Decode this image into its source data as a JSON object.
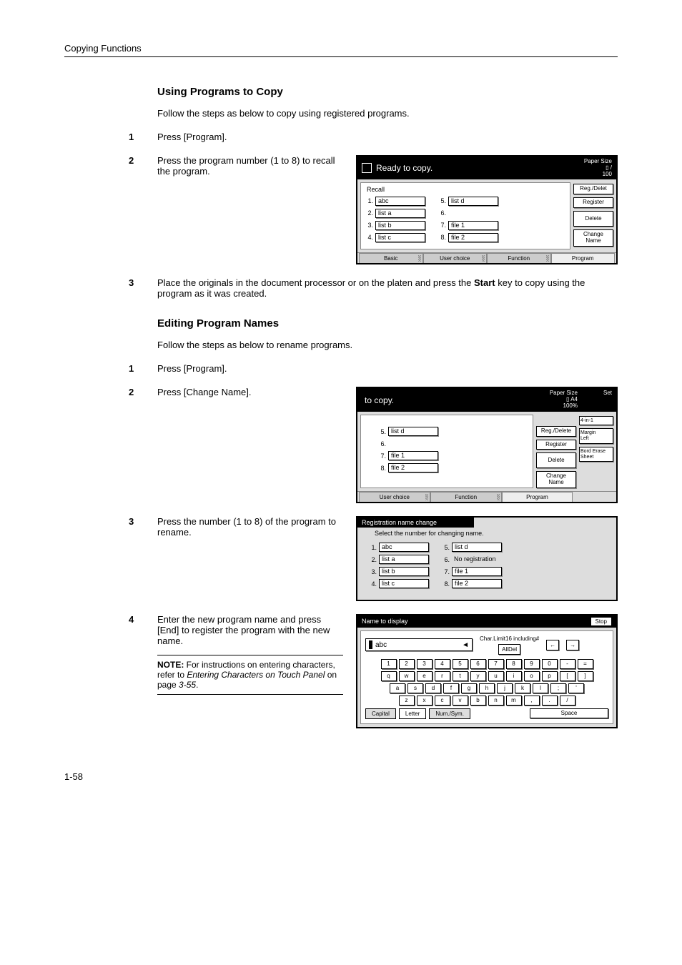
{
  "running_head": "Copying Functions",
  "section1": {
    "title": "Using Programs to Copy",
    "intro": "Follow the steps as below to copy using registered programs.",
    "steps": {
      "s1": {
        "text": "Press [Program]."
      },
      "s2": {
        "text": "Press the program number (1 to 8) to recall the program."
      },
      "s3": {
        "text_a": "Place the originals in the document processor or on the platen and press the ",
        "bold": "Start",
        "text_b": " key to copy using the program as it was created."
      }
    }
  },
  "section2": {
    "title": "Editing Program Names",
    "intro": "Follow the steps as below to rename programs.",
    "steps": {
      "s1": {
        "text": "Press [Program]."
      },
      "s2": {
        "text": "Press [Change Name]."
      },
      "s3": {
        "text": "Press the number (1 to 8) of the program to rename."
      },
      "s4": {
        "text": "Enter the new program name and press [End] to register the program with the new name."
      }
    },
    "note": {
      "label": "NOTE:",
      "a": " For instructions on entering characters, refer to ",
      "link": "Entering Characters on Touch Panel",
      "b": " on page ",
      "page": "3-55",
      "c": "."
    }
  },
  "screen1": {
    "title": "Ready to copy.",
    "paper": "Paper Size",
    "zoom": "100",
    "recall": "Recall",
    "slots": {
      "l1": "abc",
      "l2": "list a",
      "l3": "list b",
      "l4": "list c",
      "r5": "list d",
      "r6": "",
      "r7": "file 1",
      "r8": "file 2"
    },
    "side": {
      "regdel": "Reg./Delet",
      "register": "Register",
      "delete": "Delete",
      "change": "Change\nName"
    },
    "tabs": {
      "basic": "Basic",
      "user": "User choice",
      "func": "Function",
      "prog": "Program"
    }
  },
  "screen2": {
    "title": "to copy.",
    "paper": "Paper Size",
    "papersize": "A4",
    "zoom": "100%",
    "set": "Set",
    "slots": {
      "r5": "list d",
      "r6": "",
      "r7": "file 1",
      "r8": "file 2"
    },
    "side": {
      "regdel": "Reg./Delete",
      "register": "Register",
      "delete": "Delete",
      "change": "Change\nName"
    },
    "shortcuts": {
      "a": "4-in-1",
      "b": "Margin\nLeft",
      "c": "Bord Erase\nSheet"
    },
    "tabs": {
      "user": "User choice",
      "func": "Function",
      "prog": "Program"
    }
  },
  "screen3": {
    "bar": "Registration name change",
    "sub": "Select the number for changing name.",
    "slots": {
      "l1": "abc",
      "l2": "list a",
      "l3": "list b",
      "l4": "list c",
      "r5": "list d",
      "r6": "No registration",
      "r7": "file 1",
      "r8": "file 2"
    }
  },
  "screen4": {
    "title": "Name to display",
    "stop": "Stop",
    "entry": "abc",
    "limit": "Char.Limit16 including#",
    "alldel": "AllDel",
    "back": "←",
    "fwd": "→",
    "rows": {
      "r1": [
        "1",
        "2",
        "3",
        "4",
        "5",
        "6",
        "7",
        "8",
        "9",
        "0",
        "-",
        "="
      ],
      "r2": [
        "q",
        "w",
        "e",
        "r",
        "t",
        "y",
        "u",
        "i",
        "o",
        "p",
        "[",
        "]"
      ],
      "r3": [
        "a",
        "s",
        "d",
        "f",
        "g",
        "h",
        "j",
        "k",
        "l",
        ";",
        "'"
      ],
      "r4": [
        "z",
        "x",
        "c",
        "v",
        "b",
        "n",
        "m",
        ",",
        ".",
        "/"
      ]
    },
    "tabs": {
      "cap": "Capital",
      "let": "Letter",
      "num": "Num./Sym.",
      "space": "Space"
    }
  },
  "page_num": "1-58"
}
